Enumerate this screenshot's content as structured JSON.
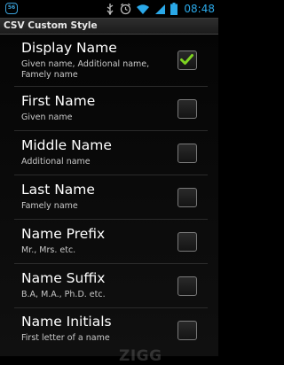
{
  "status": {
    "badge": "56",
    "time": "08:48",
    "icons": [
      "usb-icon",
      "alarm-icon",
      "wifi-icon",
      "signal-icon",
      "battery-icon"
    ]
  },
  "titlebar": {
    "title": "CSV Custom Style"
  },
  "items": [
    {
      "name": "Display Name",
      "desc": "Given name, Additional name, Famely name",
      "checked": true
    },
    {
      "name": "First Name",
      "desc": "Given name",
      "checked": false
    },
    {
      "name": "Middle Name",
      "desc": "Additional name",
      "checked": false
    },
    {
      "name": "Last Name",
      "desc": "Famely name",
      "checked": false
    },
    {
      "name": "Name Prefix",
      "desc": "Mr., Mrs. etc.",
      "checked": false
    },
    {
      "name": "Name Suffix",
      "desc": "B.A, M.A., Ph.D. etc.",
      "checked": false
    },
    {
      "name": "Name Initials",
      "desc": "First letter of a name",
      "checked": false
    }
  ],
  "watermark": "ZIGG",
  "colors": {
    "check": "#7ed321",
    "accent": "#2aa8e8"
  }
}
